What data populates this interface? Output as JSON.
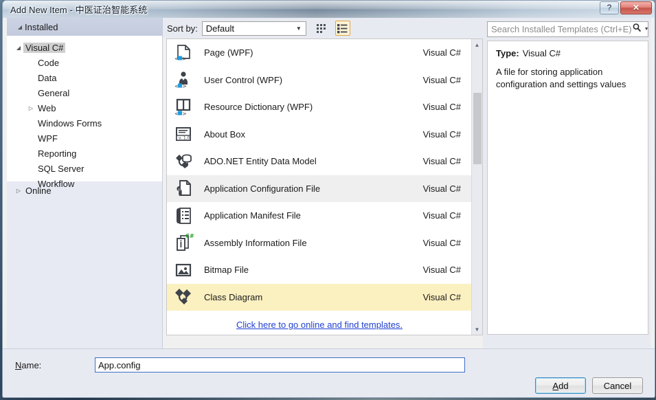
{
  "window": {
    "title": "Add New Item - 中医证治智能系统",
    "help_button": "?",
    "close_button": "✕"
  },
  "sidebar": {
    "header": "Installed",
    "header_expander": "◢",
    "items": [
      {
        "label": "Visual C#",
        "depth": 0,
        "expander": "◢",
        "selected": true
      },
      {
        "label": "Code",
        "depth": 1,
        "expander": "",
        "selected": false
      },
      {
        "label": "Data",
        "depth": 1,
        "expander": "",
        "selected": false
      },
      {
        "label": "General",
        "depth": 1,
        "expander": "",
        "selected": false
      },
      {
        "label": "Web",
        "depth": 1,
        "expander": "▷",
        "selected": false
      },
      {
        "label": "Windows Forms",
        "depth": 1,
        "expander": "",
        "selected": false
      },
      {
        "label": "WPF",
        "depth": 1,
        "expander": "",
        "selected": false
      },
      {
        "label": "Reporting",
        "depth": 1,
        "expander": "",
        "selected": false
      },
      {
        "label": "SQL Server",
        "depth": 1,
        "expander": "",
        "selected": false
      },
      {
        "label": "Workflow",
        "depth": 1,
        "expander": "",
        "selected": false
      }
    ],
    "online": {
      "label": "Online",
      "expander": "▷"
    }
  },
  "toolbar": {
    "sort_by_label": "Sort by:",
    "sort_by_value": "Default",
    "sort_by_arrow": "▼",
    "view_tiles_icon": "tiles-view-icon",
    "view_list_icon": "list-view-icon"
  },
  "templates": {
    "language_column": "Visual C#",
    "items": [
      {
        "name": "Page (WPF)",
        "lang": "Visual C#",
        "icon": "page-wpf-icon",
        "state": "normal"
      },
      {
        "name": "User Control (WPF)",
        "lang": "Visual C#",
        "icon": "user-control-wpf-icon",
        "state": "normal"
      },
      {
        "name": "Resource Dictionary (WPF)",
        "lang": "Visual C#",
        "icon": "resource-dictionary-wpf-icon",
        "state": "normal"
      },
      {
        "name": "About Box",
        "lang": "Visual C#",
        "icon": "about-box-icon",
        "state": "normal"
      },
      {
        "name": "ADO.NET Entity Data Model",
        "lang": "Visual C#",
        "icon": "ado-net-entity-data-model-icon",
        "state": "normal"
      },
      {
        "name": "Application Configuration File",
        "lang": "Visual C#",
        "icon": "application-configuration-file-icon",
        "state": "hovered"
      },
      {
        "name": "Application Manifest File",
        "lang": "Visual C#",
        "icon": "application-manifest-file-icon",
        "state": "normal"
      },
      {
        "name": "Assembly Information File",
        "lang": "Visual C#",
        "icon": "assembly-information-file-icon",
        "state": "normal"
      },
      {
        "name": "Bitmap File",
        "lang": "Visual C#",
        "icon": "bitmap-file-icon",
        "state": "normal"
      },
      {
        "name": "Class Diagram",
        "lang": "Visual C#",
        "icon": "class-diagram-icon",
        "state": "selected"
      }
    ],
    "online_link": "Click here to go online and find templates.",
    "scrollbar": {
      "up_arrow": "▲",
      "down_arrow": "▼"
    }
  },
  "search": {
    "placeholder": "Search Installed Templates (Ctrl+E)",
    "icon": "search-icon",
    "dropdown_arrow": "▼"
  },
  "info": {
    "type_label": "Type:",
    "type_value": "Visual C#",
    "description": "A file for storing application configuration and settings values"
  },
  "footer": {
    "name_label": "Name:",
    "name_value": "App.config",
    "add_label": "Add",
    "cancel_label": "Cancel"
  },
  "colors": {
    "panel_bg": "#e8eaf2",
    "selection_yellow": "#fbf0c0",
    "hover_gray": "#efefef",
    "link_blue": "#1f3fd0",
    "accent_orange": "#e0a53c",
    "close_red": "#c4564c"
  }
}
